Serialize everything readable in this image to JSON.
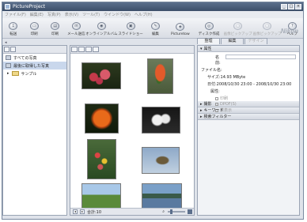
{
  "window": {
    "title": "PictureProject"
  },
  "menu": [
    "ファイル(F)",
    "編集(E)",
    "写真(P)",
    "表示(V)",
    "ツール(T)",
    "ウインドウ(W)",
    "ヘルプ(H)"
  ],
  "toolbar": {
    "items": [
      {
        "label": "転送",
        "icon": "transfer-icon"
      },
      {
        "label": "印刷",
        "icon": "print-icon"
      },
      {
        "label": "印刷",
        "icon": "print-layout-icon"
      },
      {
        "label": "メール送信",
        "icon": "mail-icon"
      },
      {
        "label": "オンラインアルバム",
        "icon": "online-album-icon"
      },
      {
        "label": "スライドショー",
        "icon": "slideshow-icon"
      },
      {
        "label": "編集",
        "icon": "edit-icon"
      },
      {
        "label": "Picturetow",
        "icon": "picturetown-icon"
      },
      {
        "label": "ディスク作成",
        "icon": "disc-icon"
      },
      {
        "label": "画像ピックアップ",
        "icon": "pickup-icon",
        "disabled": true
      },
      {
        "label": "画像ピックアップ",
        "icon": "pickup2-icon",
        "disabled": true
      },
      {
        "label": "ヘルプ",
        "icon": "help-icon"
      }
    ],
    "brand": "Nikon"
  },
  "subbar_text": "◂",
  "left_panel": {
    "items": [
      {
        "label": "すべての写真"
      },
      {
        "label": "最後に取得した写真",
        "selected": true
      },
      {
        "label": "サンプル",
        "folder": true
      }
    ]
  },
  "status": {
    "count_label": "合計:10"
  },
  "right_tabs": [
    "整理",
    "編集",
    "デザイン"
  ],
  "info": {
    "section_label": "属性",
    "name_label": "名前:",
    "file_label": "ファイル名:",
    "size_label": "サイズ:14.93 MByte",
    "date_label": "日付:2008/10/30 23:00 - 2008/10/30 23:00",
    "attr_label": "属性:",
    "checks": [
      "印刷",
      "DPOF(S)",
      "非表示"
    ]
  },
  "sections": [
    "撮影",
    "キーワード",
    "検索フィルター"
  ],
  "colors": {
    "titlebar": "#3c4e69",
    "selection": "#c9d7ec"
  }
}
